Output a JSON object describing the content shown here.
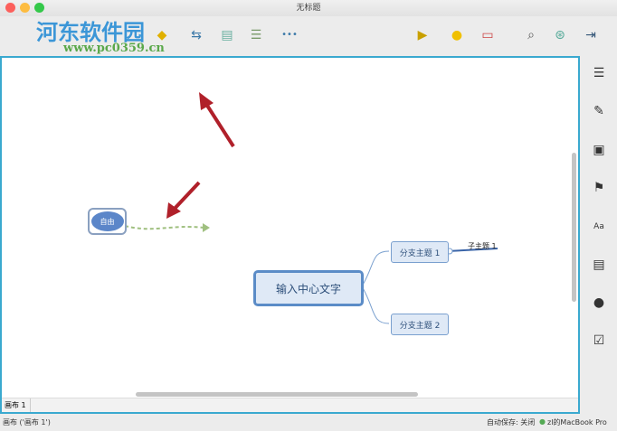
{
  "window": {
    "title": "无标题"
  },
  "watermark": {
    "name": "河东软件园",
    "url": "www.pc0359.cn"
  },
  "toolbar": {
    "more_label": "•••"
  },
  "canvas": {
    "central_topic": "输入中心文字",
    "branches": [
      "分支主题 1",
      "分支主题 2"
    ],
    "subtopic": "子主题 1",
    "floating_topic": "自由"
  },
  "tabs": {
    "sheet": "画布 1"
  },
  "status": {
    "left": "画布 ('画布 1')",
    "autosave": "自动保存: 关闭",
    "device": "zl的MacBook Pro"
  },
  "colors": {
    "accent": "#3aa9cf",
    "arrow": "#b0202a"
  }
}
